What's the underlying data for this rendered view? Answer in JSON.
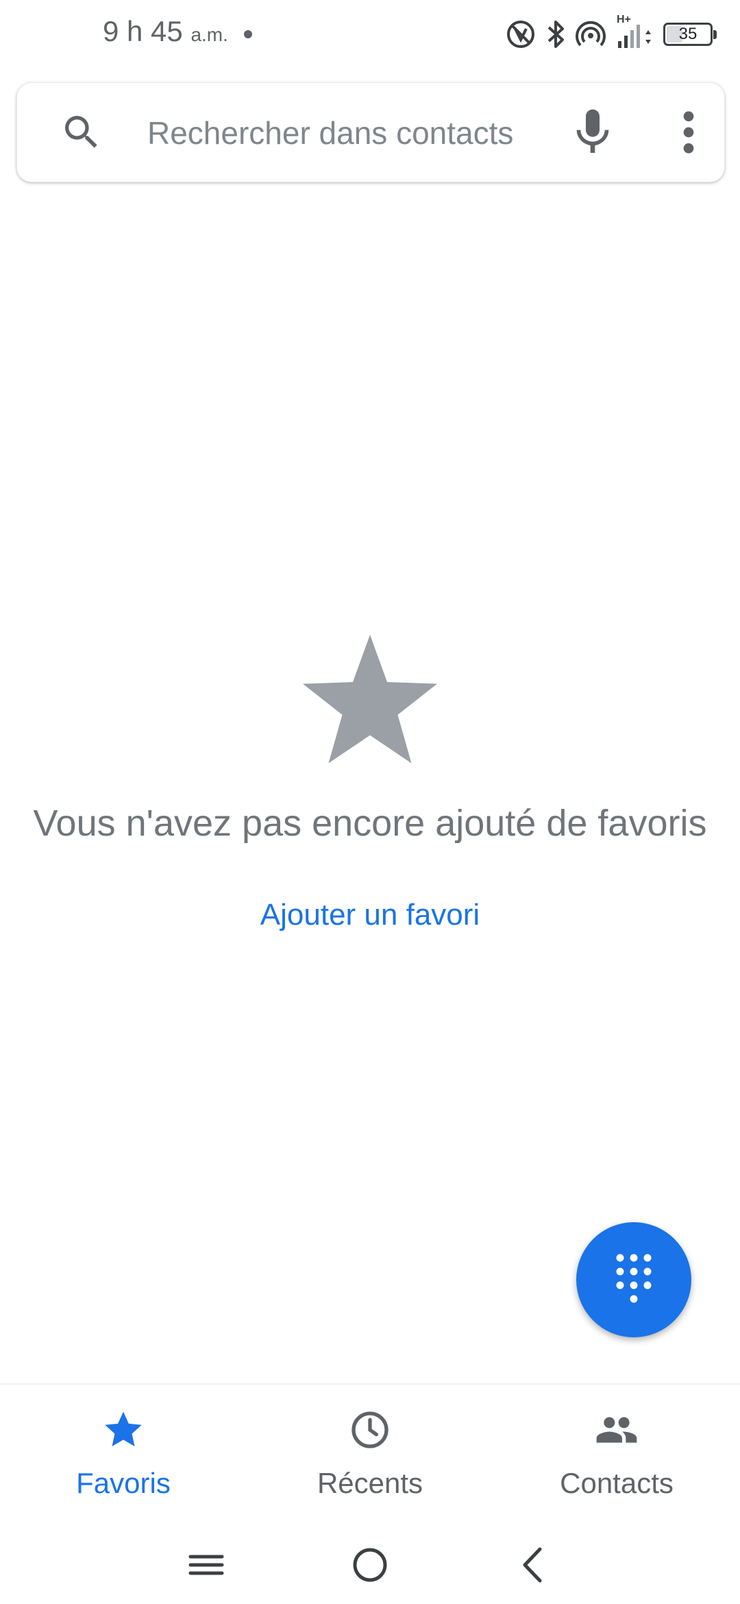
{
  "status_bar": {
    "time": "9 h 45",
    "ampm": "a.m.",
    "network_label": "H+",
    "battery_level": "35"
  },
  "search": {
    "placeholder": "Rechercher dans contacts"
  },
  "empty_state": {
    "message": "Vous n'avez pas encore ajouté de favoris",
    "add_link": "Ajouter un favori"
  },
  "bottom_nav": {
    "items": [
      {
        "label": "Favoris",
        "icon": "star-icon",
        "active": true
      },
      {
        "label": "Récents",
        "icon": "clock-icon",
        "active": false
      },
      {
        "label": "Contacts",
        "icon": "people-icon",
        "active": false
      }
    ]
  },
  "colors": {
    "accent": "#1a73e8",
    "icon_gray": "#5f6368",
    "empty_star": "#9aa0a6",
    "text_secondary": "#70757a"
  }
}
